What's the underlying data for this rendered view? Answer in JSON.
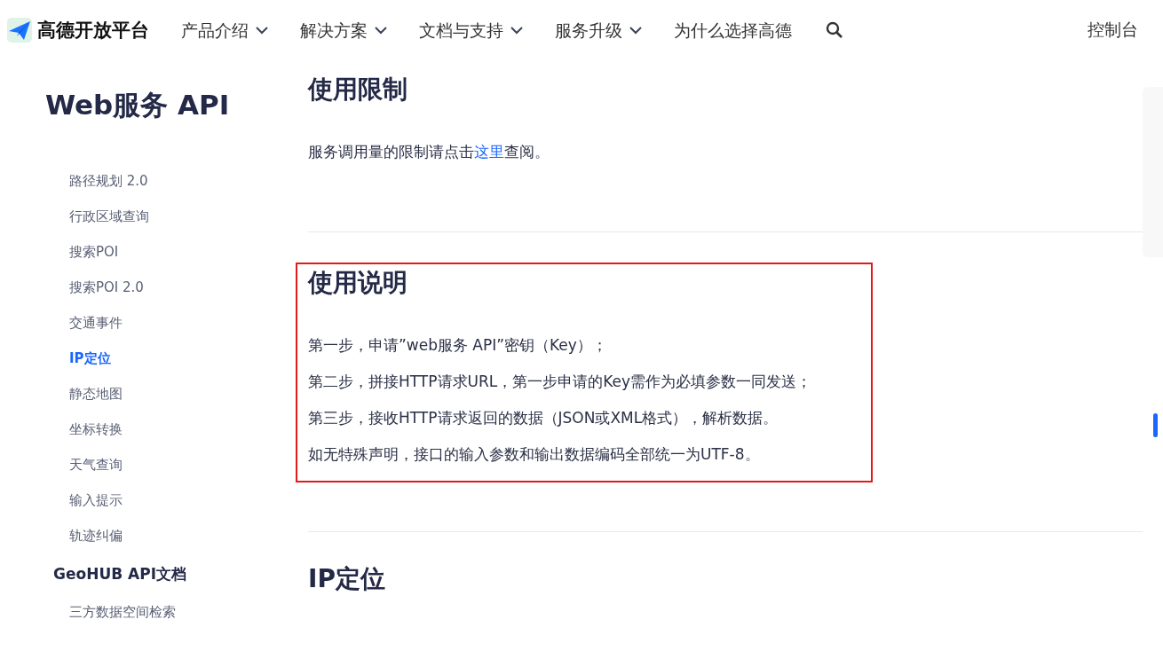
{
  "nav": {
    "brand": "高德开放平台",
    "items": [
      {
        "label": "产品介绍",
        "dropdown": true
      },
      {
        "label": "解决方案",
        "dropdown": true
      },
      {
        "label": "文档与支持",
        "dropdown": true
      },
      {
        "label": "服务升级",
        "dropdown": true
      },
      {
        "label": "为什么选择高德",
        "dropdown": false
      }
    ],
    "console": "控制台"
  },
  "sidebar": {
    "title": "Web服务 API",
    "items": [
      {
        "label": "路径规划 2.0",
        "selected": false
      },
      {
        "label": "行政区域查询",
        "selected": false
      },
      {
        "label": "搜索POI",
        "selected": false
      },
      {
        "label": "搜索POI 2.0",
        "selected": false
      },
      {
        "label": "交通事件",
        "selected": false
      },
      {
        "label": "IP定位",
        "selected": true
      },
      {
        "label": "静态地图",
        "selected": false
      },
      {
        "label": "坐标转换",
        "selected": false
      },
      {
        "label": "天气查询",
        "selected": false
      },
      {
        "label": "输入提示",
        "selected": false
      },
      {
        "label": "轨迹纠偏",
        "selected": false
      }
    ],
    "groups": [
      {
        "title": "GeoHUB API文档",
        "items": [
          {
            "label": "三方数据空间检索",
            "selected": false
          }
        ]
      }
    ]
  },
  "sections": [
    {
      "heading": "使用限制",
      "highlighted": false,
      "paragraphs": [
        {
          "before": "服务调用量的限制请点击",
          "link": "这里",
          "after": "查阅。"
        }
      ]
    },
    {
      "heading": "使用说明",
      "highlighted": true,
      "paragraphs": [
        {
          "before": "第一步，申请”web服务 API”密钥（Key）；"
        },
        {
          "before": "第二步，拼接HTTP请求URL，第一步申请的Key需作为必填参数一同发送；"
        },
        {
          "before": "第三步，接收HTTP请求返回的数据（JSON或XML格式），解析数据。"
        },
        {
          "before": "如无特殊声明，接口的输入参数和输出数据编码全部统一为UTF-8。"
        }
      ]
    },
    {
      "heading": "IP定位",
      "highlighted": false
    }
  ]
}
